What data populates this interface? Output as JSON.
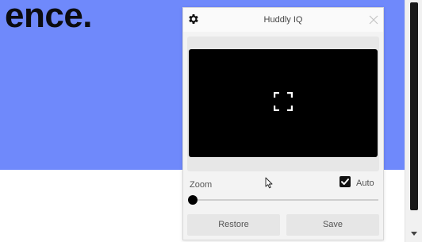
{
  "background": {
    "headline": "ence.",
    "hero_color": "#6f89fb"
  },
  "panel": {
    "title": "Huddly IQ",
    "icons": {
      "settings": "gear-icon",
      "close": "close-icon",
      "fullscreen": "fullscreen-icon",
      "cursor": "cursor-icon"
    },
    "zoom": {
      "label": "Zoom",
      "value": 0
    },
    "auto": {
      "label": "Auto",
      "checked": true
    },
    "buttons": {
      "restore": "Restore",
      "save": "Save"
    }
  }
}
